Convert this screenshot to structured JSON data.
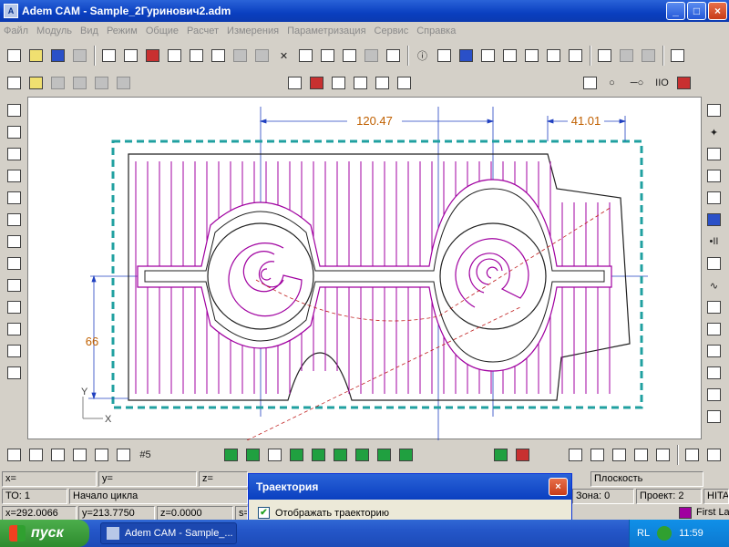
{
  "window": {
    "title": "Adem CAM - Sample_2Гуринович2.adm",
    "minimize": "_",
    "maximize": "□",
    "close": "×",
    "app_icon": "adem-icon"
  },
  "menu": [
    "Файл",
    "Модуль",
    "Вид",
    "Режим",
    "Общие",
    "Расчет",
    "Измерения",
    "Параметризация",
    "Сервис",
    "Справка"
  ],
  "drawing": {
    "dim_top": "120.47",
    "dim_right": "41.01",
    "dim_left": "66",
    "axis_y": "Y",
    "axis_x": "X",
    "colors": {
      "part": "#a000a0",
      "outline": "#202020",
      "boundary": "#20a0a0",
      "dim": "#2040c0",
      "dimtext": "#c06000"
    }
  },
  "status": {
    "x_label": "x=",
    "y_label": "y=",
    "z_label": "z=",
    "plane": "Плоскость",
    "to": "ТО: 1",
    "cycle": "Начало цикла",
    "x_val": "x=292.0066",
    "y_val": "y=213.7750",
    "z_val": "z=0.0000",
    "s_label": "s=",
    "zone": "Зона: 0",
    "project": "Проект: 2",
    "hita": "HITA",
    "first": "First La"
  },
  "dialog": {
    "title": "Траектория",
    "checkbox_label": "Отображать траекторию",
    "checked": true
  },
  "taskbar": {
    "start": "пуск",
    "item": "Adem CAM - Sample_...",
    "lang": "RL",
    "time": "11:59"
  }
}
